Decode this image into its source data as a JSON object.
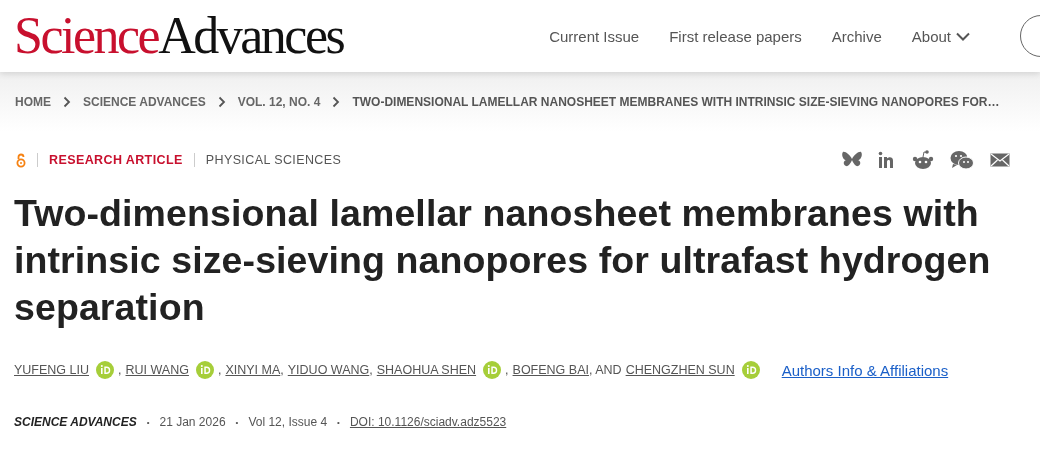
{
  "logo": {
    "part_1": "Science",
    "part_2": "Advances"
  },
  "nav": [
    "Current Issue",
    "First release papers",
    "Archive",
    "About"
  ],
  "breadcrumb": [
    "HOME",
    "SCIENCE ADVANCES",
    "VOL. 12, NO. 4",
    "TWO-DIMENSIONAL LAMELLAR NANOSHEET MEMBRANES WITH INTRINSIC SIZE-SIEVING NANOPORES FOR…"
  ],
  "article_type": "RESEARCH ARTICLE",
  "subject": "PHYSICAL SCIENCES",
  "title": "Two-dimensional lamellar nanosheet membranes with intrinsic size-sieving nanopores for ultrafast hydrogen separation",
  "authors": [
    {
      "name": "YUFENG LIU",
      "orcid": true,
      "separator": ","
    },
    {
      "name": "RUI WANG",
      "orcid": true,
      "separator": ","
    },
    {
      "name": "XINYI MA",
      "orcid": false,
      "separator": ","
    },
    {
      "name": "YIDUO WANG",
      "orcid": false,
      "separator": ","
    },
    {
      "name": "SHAOHUA SHEN",
      "orcid": true,
      "separator": ","
    },
    {
      "name": "BOFENG BAI",
      "orcid": false,
      "separator": ", AND"
    },
    {
      "name": "CHENGZHEN SUN",
      "orcid": true
    }
  ],
  "authors_link": "Authors Info & Affiliations",
  "meta": {
    "journal": "SCIENCE ADVANCES",
    "separator": "•",
    "date": "21 Jan 2026",
    "issue": "Vol 12, Issue 4",
    "doi": "DOI: 10.1126/sciadv.adz5523"
  }
}
